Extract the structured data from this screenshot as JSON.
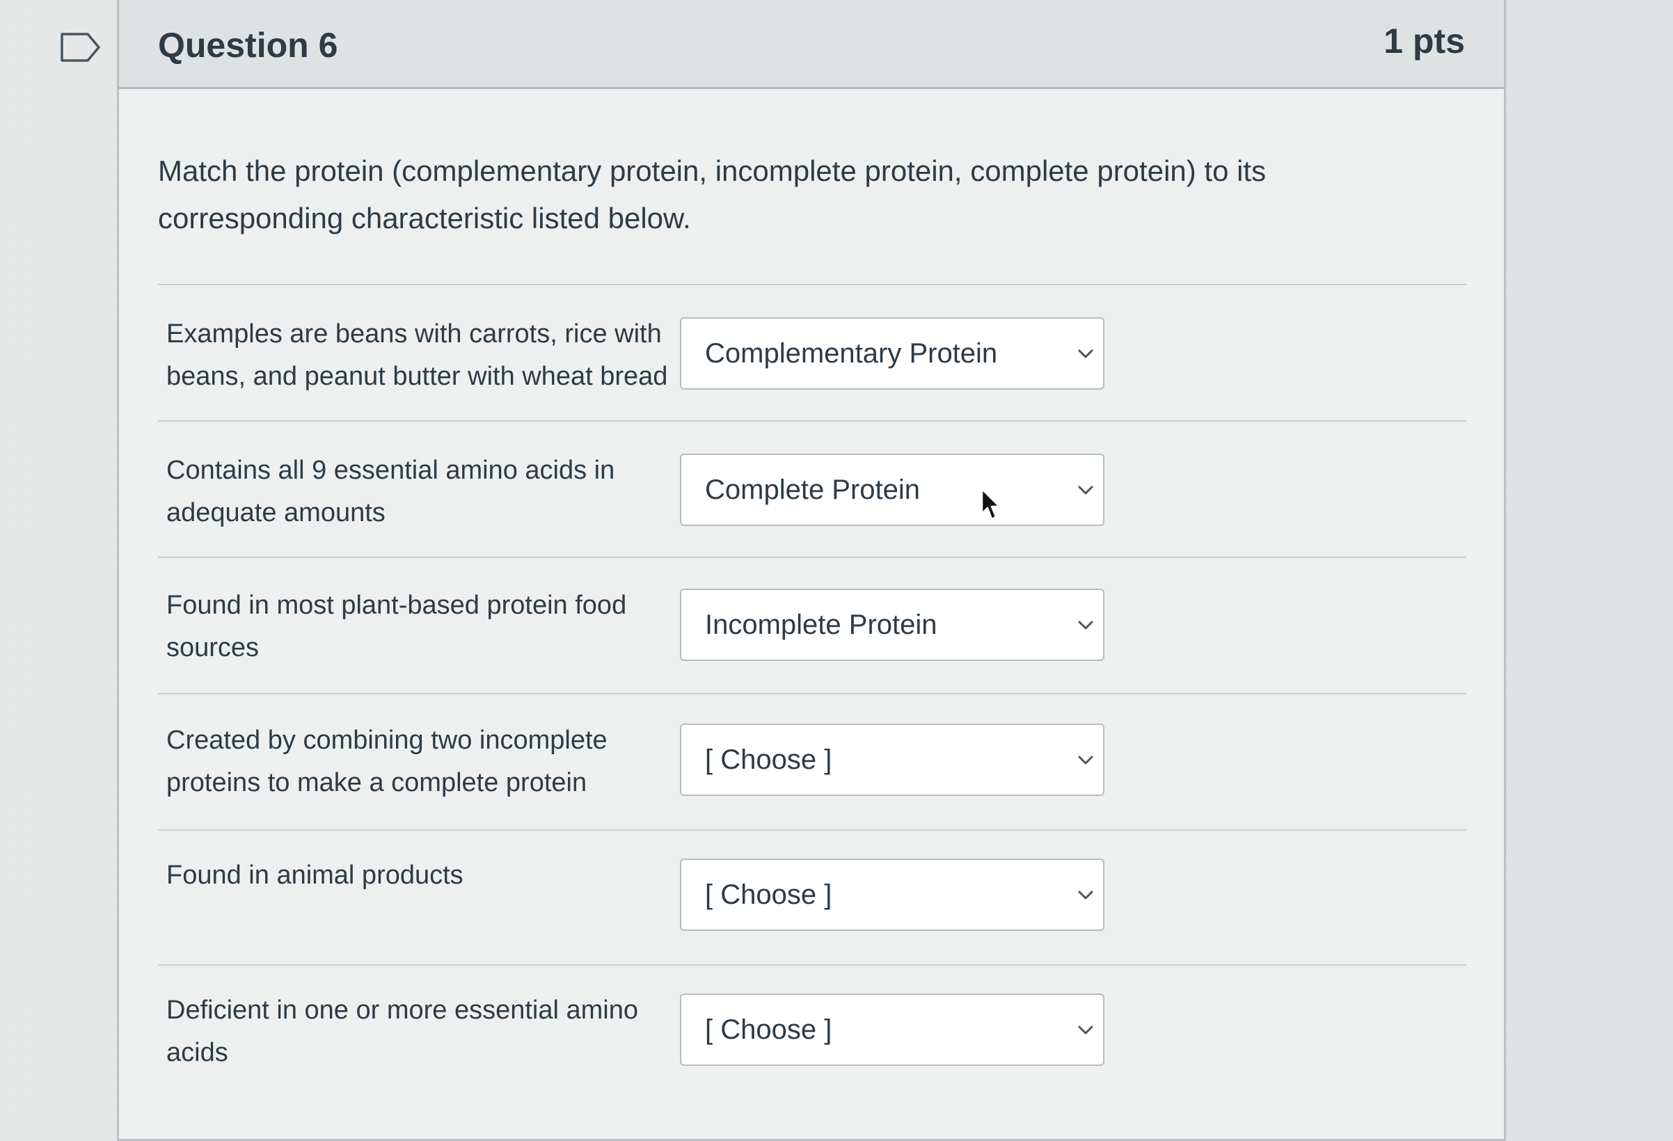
{
  "question": {
    "title": "Question 6",
    "points": "1 pts",
    "prompt": "Match the protein (complementary protein, incomplete protein, complete protein) to its corresponding characteristic listed below."
  },
  "rows": [
    {
      "label": "Examples are beans with carrots, rice with beans, and peanut butter with wheat bread",
      "selected": "Complementary Protein"
    },
    {
      "label": "Contains all 9 essential amino acids in adequate amounts",
      "selected": "Complete Protein"
    },
    {
      "label": "Found in most plant-based protein food sources",
      "selected": "Incomplete Protein"
    },
    {
      "label": "Created by combining two incomplete proteins to make a complete protein",
      "selected": "[ Choose ]"
    },
    {
      "label": "Found in animal products",
      "selected": "[ Choose ]"
    },
    {
      "label": "Deficient in one or more essential amino acids",
      "selected": "[ Choose ]"
    }
  ],
  "icons": {
    "flag": "flag-icon",
    "dropdown": "chevron-down-icon",
    "cursor": "mouse-cursor-icon"
  },
  "colors": {
    "text": "#2d3b45",
    "header_background": "#dfe2e3",
    "card_background": "#eef0f0",
    "border": "#b9bfc3"
  }
}
